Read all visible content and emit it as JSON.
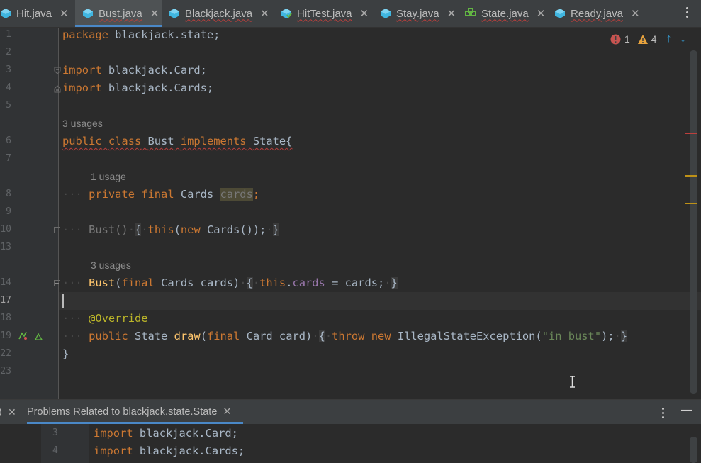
{
  "tabs": [
    {
      "label": "Hit.java",
      "icon": "java-class-icon",
      "active": false,
      "error": false
    },
    {
      "label": "Bust.java",
      "icon": "java-class-icon",
      "active": true,
      "error": true
    },
    {
      "label": "Blackjack.java",
      "icon": "java-class-icon",
      "active": false,
      "error": true
    },
    {
      "label": "HitTest.java",
      "icon": "java-test-class-icon",
      "active": false,
      "error": true
    },
    {
      "label": "Stay.java",
      "icon": "java-class-icon",
      "active": false,
      "error": true
    },
    {
      "label": "State.java",
      "icon": "java-interface-icon",
      "active": false,
      "error": true
    },
    {
      "label": "Ready.java",
      "icon": "java-class-icon",
      "active": false,
      "error": true
    }
  ],
  "tab_close_glyph": "✕",
  "inspections": {
    "errors": "1",
    "warnings": "4",
    "up_arrow": "↑",
    "down_arrow": "↓"
  },
  "line_numbers": [
    "1",
    "2",
    "3",
    "4",
    "5",
    "6",
    "7",
    "8",
    "9",
    "10",
    "13",
    "14",
    "17",
    "18",
    "19",
    "22",
    "23"
  ],
  "code": {
    "l1_kw": "package",
    "l1_rest": "blackjack.state;",
    "l3_kw": "import",
    "l3_rest": "blackjack.Card;",
    "l4_kw": "import",
    "l4_rest": "blackjack.Cards;",
    "hint_class": "3 usages",
    "l6_public": "public",
    "l6_class": "class",
    "l6_name": "Bust",
    "l6_implements": "implements",
    "l6_state": "State{",
    "hint_field": "1 usage",
    "l8_private": "private",
    "l8_final": "final",
    "l8_type": "Cards",
    "l8_field": "cards",
    "l8_semi": ";",
    "l10_ctor": "Bust()",
    "l10_open": "{",
    "l10_this": "this",
    "l10_paren": "(",
    "l10_new": "new",
    "l10_rest": "Cards());",
    "l10_close": "}",
    "hint_ctor": "3 usages",
    "l14_name": "Bust",
    "l14_paren": "(",
    "l14_final": "final",
    "l14_params": "Cards cards)",
    "l14_open": "{",
    "l14_this": "this",
    "l14_dot": ".",
    "l14_field": "cards",
    "l14_assign": "= cards;",
    "l14_close": "}",
    "l18_ann": "@Override",
    "l19_public": "public",
    "l19_type": "State",
    "l19_method": "draw",
    "l19_paren": "(",
    "l19_final": "final",
    "l19_params": "Card card)",
    "l19_open": "{",
    "l19_throw": "throw",
    "l19_new": "new",
    "l19_ex": "IllegalStateException(",
    "l19_str": "\"in bust\"",
    "l19_end": ");",
    "l19_close": "}",
    "l22_brace": "}"
  },
  "problems_panel": {
    "tab_label": "Problems Related to blackjack.state.State",
    "left_glyph": ")",
    "close_glyph": "✕",
    "minimize_glyph": "—",
    "line_numbers": [
      "3",
      "4"
    ],
    "lines": [
      {
        "kw": "import",
        "rest": "blackjack.Card;"
      },
      {
        "kw": "import",
        "rest": "blackjack.Cards;"
      }
    ]
  },
  "colors": {
    "keyword": "#cc7832",
    "method": "#ffc66d",
    "field": "#9876aa",
    "string": "#6a8759",
    "annotation": "#bbb529",
    "accent": "#4a88c7",
    "error": "#bc3f3c",
    "warning": "#be9117"
  }
}
